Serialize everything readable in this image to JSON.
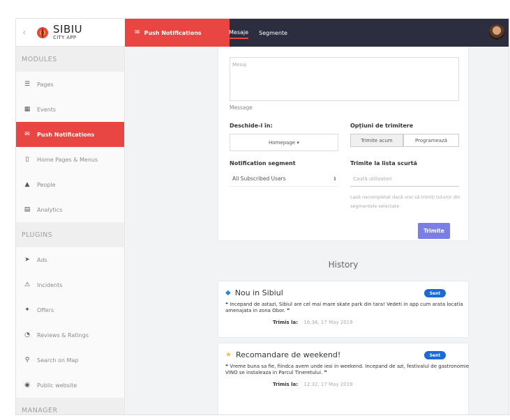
{
  "header": {
    "back_icon": "chevron-left-icon",
    "app_name": "SIBIU",
    "app_sub": "CITY APP",
    "module_title": "Push Notifications",
    "tabs": [
      {
        "label": "Mesaje",
        "active": true
      },
      {
        "label": "Segmente",
        "active": false
      }
    ]
  },
  "sidebar": {
    "modules_title": "MODULES",
    "modules": [
      {
        "label": "Pages",
        "icon": "list-icon"
      },
      {
        "label": "Events",
        "icon": "calendar-icon"
      },
      {
        "label": "Push Notifications",
        "icon": "envelope-icon",
        "active": true
      },
      {
        "label": "Home Pages & Menus",
        "icon": "mobile-icon"
      },
      {
        "label": "People",
        "icon": "user-icon"
      },
      {
        "label": "Analytics",
        "icon": "chart-icon"
      }
    ],
    "plugins_title": "PLUGINS",
    "plugins": [
      {
        "label": "Ads",
        "icon": "megaphone-icon"
      },
      {
        "label": "Incidents",
        "icon": "warning-icon"
      },
      {
        "label": "Offers",
        "icon": "tag-icon"
      },
      {
        "label": "Reviews & Ratings",
        "icon": "comment-icon"
      },
      {
        "label": "Search on Map",
        "icon": "search-icon"
      },
      {
        "label": "Public website",
        "icon": "globe-icon"
      }
    ],
    "manager_title": "MANAGER"
  },
  "form": {
    "message_placeholder": "Mesaj",
    "message_label": "Message",
    "open_in_label": "Deschide-l în:",
    "open_in_value": "Homepage ▾",
    "send_options_label": "Opțiuni de trimitere",
    "send_now": "Trimite acum",
    "schedule": "Programează",
    "segment_label": "Notification segment",
    "segment_value": "All Subscribed Users",
    "shortlist_label": "Trimite la lista scurtă",
    "search_placeholder": "Caută utilizatori",
    "hint": "Lasă necompletat dacă vrei să trimiți tuturor din segmentele selectate",
    "submit": "Trimite"
  },
  "history": {
    "title": "History",
    "items": [
      {
        "title": "Nou in Sibiul",
        "icon": "diamond-icon",
        "badge": "Sent",
        "body": "Incepand de astazi, Sibiul are cel mai mare skate park din tara! Vedeti in app cum arata locatia amenajata in zona Obor.",
        "sent_label": "Trimis la:",
        "sent_at": "16:36, 17 May 2019"
      },
      {
        "title": "Recomandare de weekend!",
        "icon": "star-icon",
        "badge": "Sent",
        "body": "Vreme buna sa fie, fiindca avem unde iesi in weekend. Incepand de azi, festivalul de gastronomie VINO se instaleaza in Parcul Tineretului.",
        "sent_label": "Trimis la:",
        "sent_at": "12:32, 17 May 2019"
      }
    ]
  },
  "colors": {
    "accent": "#e84543",
    "topbar": "#2c2e3f",
    "submit": "#7b7ee6",
    "badge": "#1e6ad5"
  }
}
